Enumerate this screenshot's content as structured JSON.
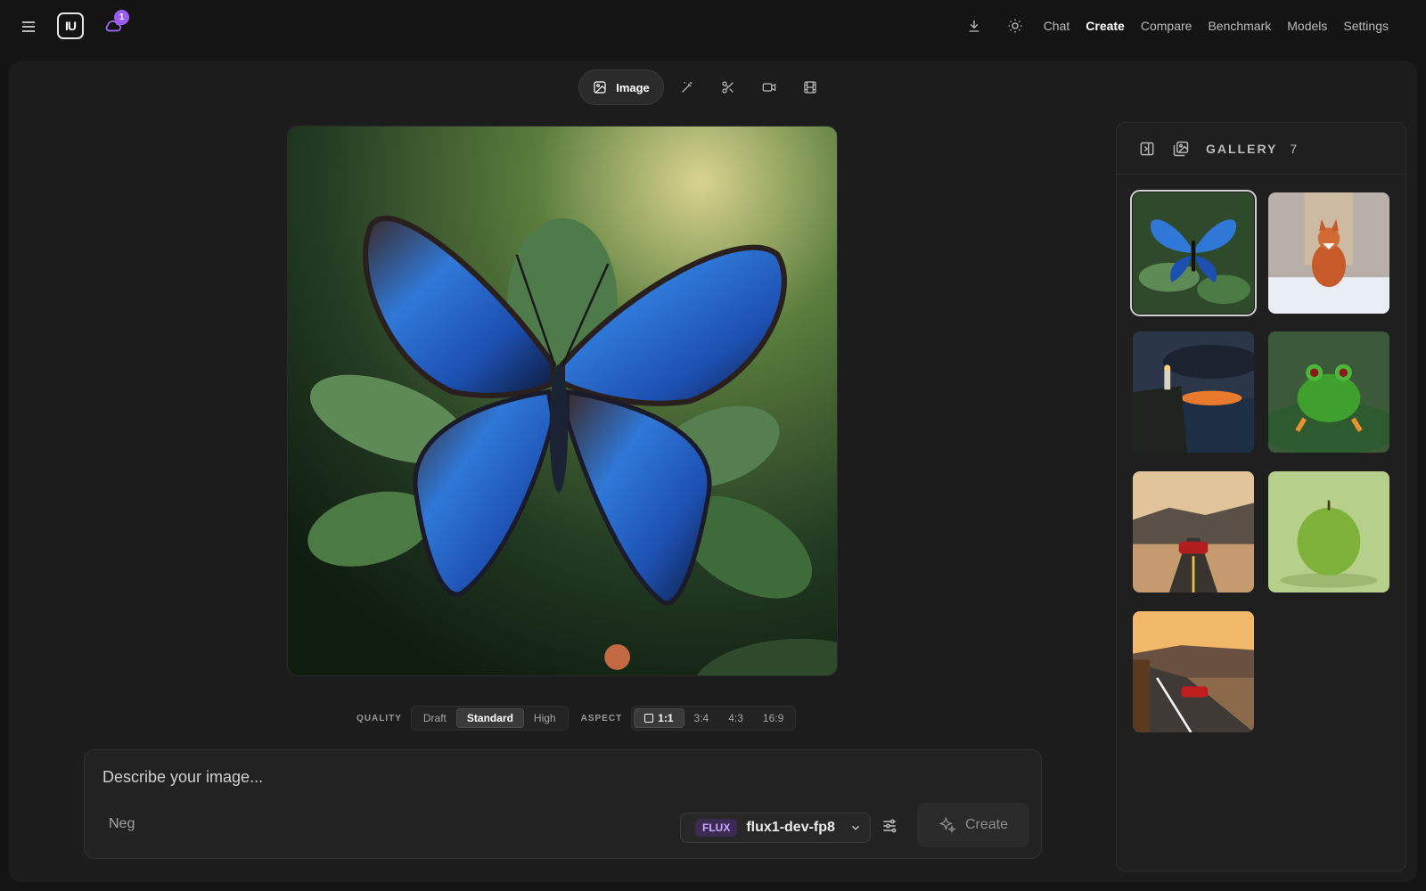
{
  "topbar": {
    "menu_icon": "hamburger-icon",
    "logo_text": "IU",
    "notifications_count": "1",
    "nav": [
      {
        "label": "Chat",
        "active": false
      },
      {
        "label": "Create",
        "active": true
      },
      {
        "label": "Compare",
        "active": false
      },
      {
        "label": "Benchmark",
        "active": false
      },
      {
        "label": "Models",
        "active": false
      },
      {
        "label": "Settings",
        "active": false
      }
    ]
  },
  "modes": {
    "image_label": "Image"
  },
  "settings": {
    "quality_label": "QUALITY",
    "quality_options": [
      "Draft",
      "Standard",
      "High"
    ],
    "quality_selected": "Standard",
    "aspect_label": "ASPECT",
    "aspect_options": [
      "1:1",
      "3:4",
      "4:3",
      "16:9"
    ],
    "aspect_selected": "1:1"
  },
  "prompt": {
    "placeholder": "Describe your image...",
    "negative_placeholder": "Neg",
    "model_tag": "FLUX",
    "model_name": "flux1-dev-fp8",
    "create_label": "Create"
  },
  "gallery": {
    "title": "GALLERY",
    "count": "7",
    "items": [
      "butterfly",
      "fox",
      "lighthouse",
      "frog",
      "car-road",
      "apple",
      "car-sunset"
    ],
    "selected": "butterfly"
  },
  "colors": {
    "accent": "#9b5cf6",
    "background": "#141414",
    "panel": "#1c1c1c"
  }
}
